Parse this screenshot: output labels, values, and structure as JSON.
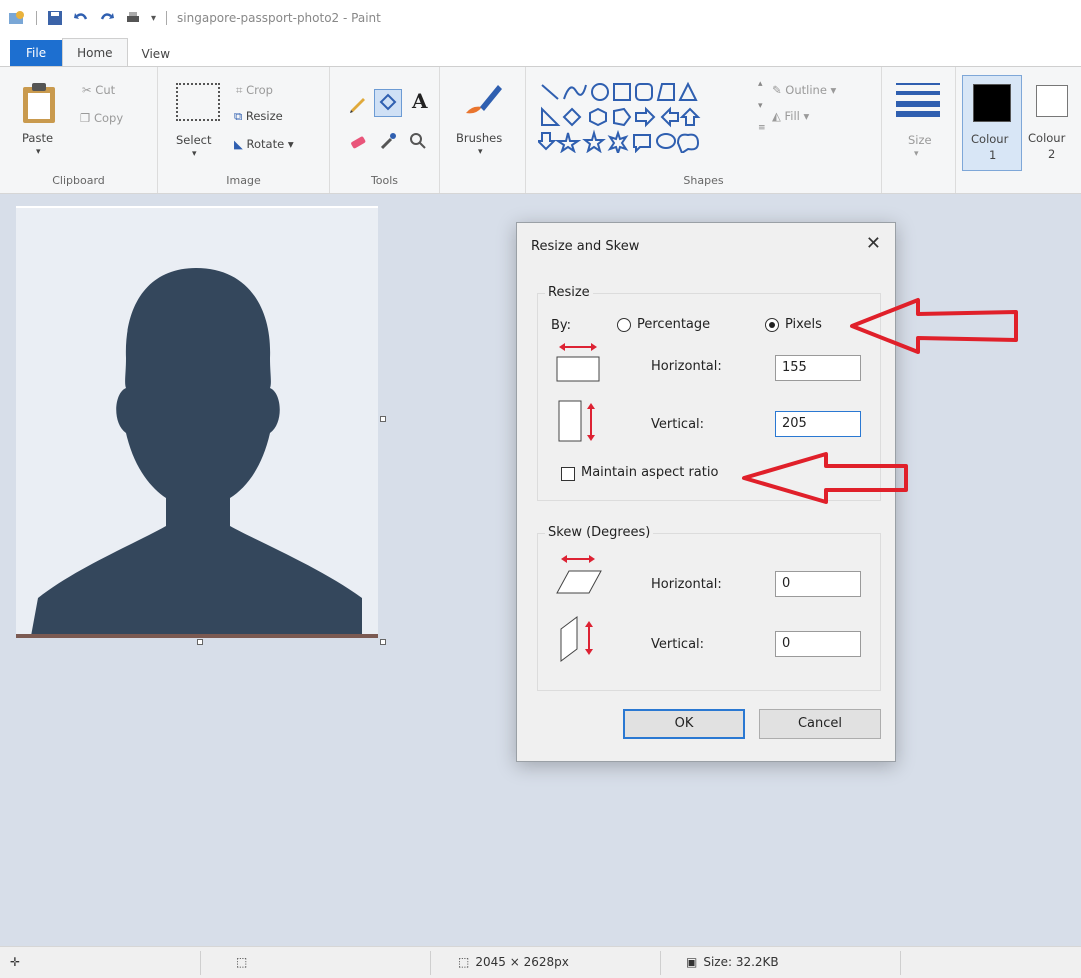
{
  "window": {
    "title": "singapore-passport-photo2 - Paint"
  },
  "tabs": [
    "File",
    "Home",
    "View"
  ],
  "ribbon": {
    "clipboard": {
      "paste": "Paste",
      "cut": "Cut",
      "copy": "Copy",
      "label": "Clipboard"
    },
    "image": {
      "select": "Select",
      "crop": "Crop",
      "resize": "Resize",
      "rotate": "Rotate",
      "label": "Image"
    },
    "tools": {
      "label": "Tools",
      "text_glyph": "A"
    },
    "brushes": {
      "label": "Brushes"
    },
    "shapes": {
      "outline": "Outline",
      "fill": "Fill",
      "label": "Shapes"
    },
    "size": {
      "label": "Size"
    },
    "colours": {
      "colour1_a": "Colour",
      "colour1_b": "1",
      "colour2_a": "Colour",
      "colour2_b": "2",
      "colour1_hex": "#000000",
      "colour2_hex": "#ffffff"
    }
  },
  "dialog": {
    "title": "Resize and Skew",
    "resize": {
      "legend": "Resize",
      "by_label": "By:",
      "percentage_label": "Percentage",
      "pixels_label": "Pixels",
      "selected": "Pixels",
      "horizontal_label": "Horizontal:",
      "horizontal_value": "155",
      "vertical_label": "Vertical:",
      "vertical_value": "205",
      "maintain_label": "Maintain aspect ratio",
      "maintain_checked": false
    },
    "skew": {
      "legend": "Skew (Degrees)",
      "horizontal_label": "Horizontal:",
      "horizontal_value": "0",
      "vertical_label": "Vertical:",
      "vertical_value": "0"
    },
    "ok": "OK",
    "cancel": "Cancel"
  },
  "statusbar": {
    "dimensions": "2045 × 2628px",
    "size": "Size: 32.2KB"
  },
  "colors": {
    "accent": "#1d6fd0",
    "annotation_arrow": "#e0202a",
    "silhouette": "#34475c",
    "canvas_bg": "#d7dee9"
  }
}
